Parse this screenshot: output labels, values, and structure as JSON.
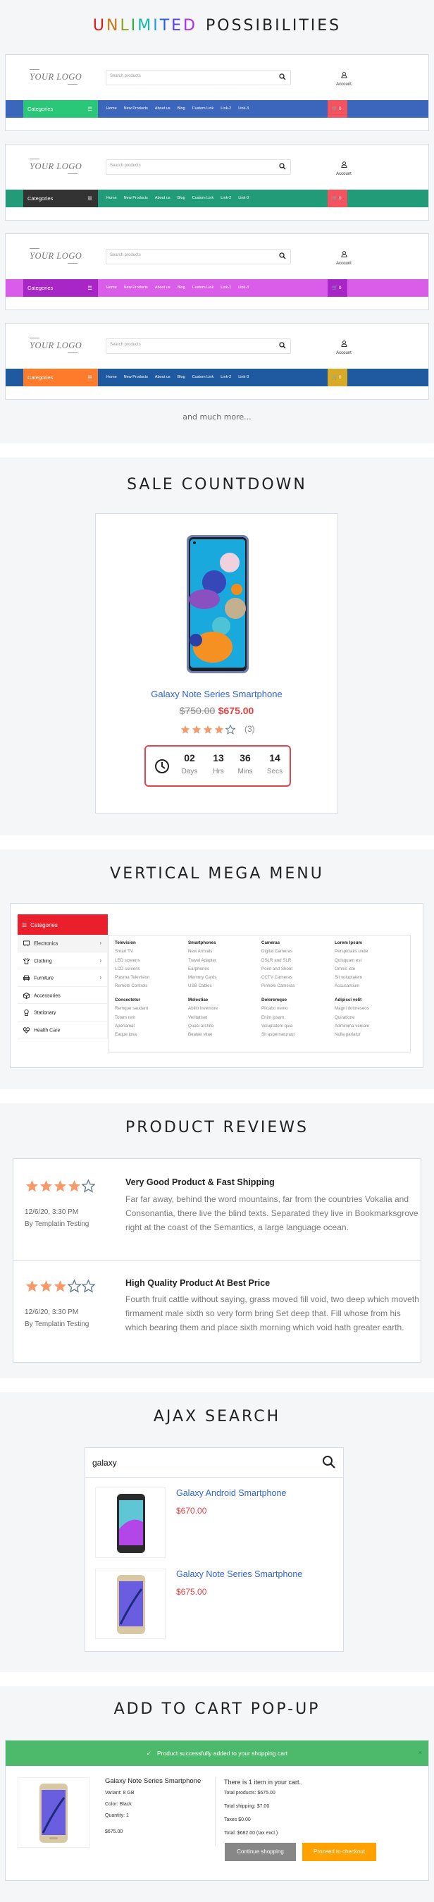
{
  "sections": {
    "unlimited": {
      "title_color_word": "UNLIMITED",
      "title_rest": "POSSIBILITIES",
      "more": "and much more..."
    },
    "sale": {
      "title": "SALE  COUNTDOWN"
    },
    "mega": {
      "title": "VERTICAL  MEGA  MENU"
    },
    "reviews": {
      "title": "PRODUCT  REVIEWS"
    },
    "ajax": {
      "title": "AJAX  SEARCH"
    },
    "cart": {
      "title": "ADD  TO  CART  POP-UP"
    }
  },
  "header_demo": {
    "logo": "YOUR  LOGO",
    "search_placeholder": "Search products",
    "account_label": "Account",
    "categories_label": "Categories",
    "nav_links": [
      "Home",
      "New Products",
      "About us",
      "Blog",
      "Custom Link",
      "Link-2",
      "Link-3"
    ],
    "cart_count": "0",
    "variants": [
      {
        "nav_color": "#3c66bb",
        "cat_color": "#2bc778",
        "cart_color": "#f2535e"
      },
      {
        "nav_color": "#219b78",
        "cat_color": "#333333",
        "cart_color": "#f2535e"
      },
      {
        "nav_color": "#d95de8",
        "cat_color": "#a825c6",
        "cart_color": "#a825c6"
      },
      {
        "nav_color": "#1f5aa0",
        "cat_color": "#fd7b2a",
        "cart_color": "#d9a928"
      }
    ]
  },
  "countdown": {
    "product_name": "Galaxy Note Series Smartphone",
    "old_price": "$750.00",
    "price": "$675.00",
    "rating": 4,
    "rating_max": 5,
    "review_count": "(3)",
    "units": [
      {
        "value": "02",
        "label": "Days"
      },
      {
        "value": "13",
        "label": "Hrs"
      },
      {
        "value": "36",
        "label": "Mins"
      },
      {
        "value": "14",
        "label": "Secs"
      }
    ]
  },
  "mega_menu": {
    "header": "Categories",
    "items": [
      {
        "label": "Electronics",
        "icon": "tv-icon",
        "has_sub": true
      },
      {
        "label": "Clothing",
        "icon": "tshirt-icon",
        "has_sub": true
      },
      {
        "label": "Furniture",
        "icon": "sofa-icon",
        "has_sub": true
      },
      {
        "label": "Accessories",
        "icon": "box-icon",
        "has_sub": false
      },
      {
        "label": "Stationary",
        "icon": "badge-icon",
        "has_sub": false
      },
      {
        "label": "Health Care",
        "icon": "heart-pulse-icon",
        "has_sub": false
      }
    ],
    "columns": [
      {
        "heading": "Television",
        "items": [
          "Smart TV",
          "LED screens",
          "LCD screens",
          "Plasma Television",
          "Remote Controls"
        ]
      },
      {
        "heading": "Smartphones",
        "items": [
          "New Arrivals",
          "Travel Adapter",
          "Earphones",
          "Memory Cards",
          "USB Cables"
        ]
      },
      {
        "heading": "Cameras",
        "items": [
          "Digital Cameras",
          "DSLR and SLR",
          "Point and Shoot",
          "CCTV Cameras",
          "Pinhole Cameras"
        ]
      },
      {
        "heading": "Lorem Ipsum",
        "items": [
          "Perspiciatis unde",
          "Quisquam est",
          "Omnis iste",
          "Sit voluptatem",
          "Accusantium"
        ]
      },
      {
        "heading": "Consectetur",
        "items": [
          "Remque saudant",
          "Totam rem",
          "Aperiamal",
          "Eaque ipsa"
        ]
      },
      {
        "heading": "Molestiae",
        "items": [
          "Abillo inventore",
          "Veritatiset",
          "Quasi archite",
          "Beatae vitae"
        ]
      },
      {
        "heading": "Doloremque",
        "items": [
          "Plicabo nemo",
          "Enim ipsam",
          "Voluptatem quia",
          "Sit aspernaturaut"
        ]
      },
      {
        "heading": "Adipisci velit",
        "items": [
          "Magni doloreseos",
          "Quiratione",
          "Adminima veniam",
          "Nulla pariatur"
        ]
      }
    ]
  },
  "reviews": [
    {
      "rating": 4,
      "date": "12/6/20, 3:30 PM",
      "author": "By Templatin Testing",
      "title": "Very Good Product & Fast Shipping",
      "body": "Far far away, behind the word mountains, far from the countries Vokalia and Consonantia, there live the blind texts. Separated they live in Bookmarksgrove right at the coast of the Semantics, a large language ocean."
    },
    {
      "rating": 3,
      "date": "12/6/20, 3:30 PM",
      "author": "By Templatin Testing",
      "title": "High Quality Product At Best Price",
      "body": "Fourth fruit cattle without saying, grass moved fill void, two deep which moveth firmament male sixth so very form bring Set deep that. Fill whose from his which bearing them and place sixth morning which void hath greater earth."
    }
  ],
  "ajax_search": {
    "query": "galaxy",
    "results": [
      {
        "name": "Galaxy Android Smartphone",
        "price": "$670.00"
      },
      {
        "name": "Galaxy Note Series Smartphone",
        "price": "$675.00"
      }
    ]
  },
  "cart_popup": {
    "message": "Product successfully added to your shopping cart",
    "close": "×",
    "product_name": "Galaxy Note Series Smartphone",
    "variant": "Variant: 8 GB",
    "color": "Color: Black",
    "quantity": "Quantity: 1",
    "price": "$675.00",
    "summary_title": "There is 1 item in your cart.",
    "total_products": "Total products: $675.00",
    "total_shipping": "Total shipping: $7.00",
    "taxes": "Taxes $0.00",
    "total": "Total: $682.00 (tax excl.)",
    "continue_label": "Continue shopping",
    "checkout_label": "Proceed to checkout"
  },
  "colors": {
    "star_filled": "#f59a6b",
    "star_empty": "#5d7888",
    "link_blue": "#2f63d5",
    "price_red": "#e74143",
    "success_green": "#4db96b",
    "checkout_orange": "#ffa100",
    "continue_gray": "#878787"
  }
}
